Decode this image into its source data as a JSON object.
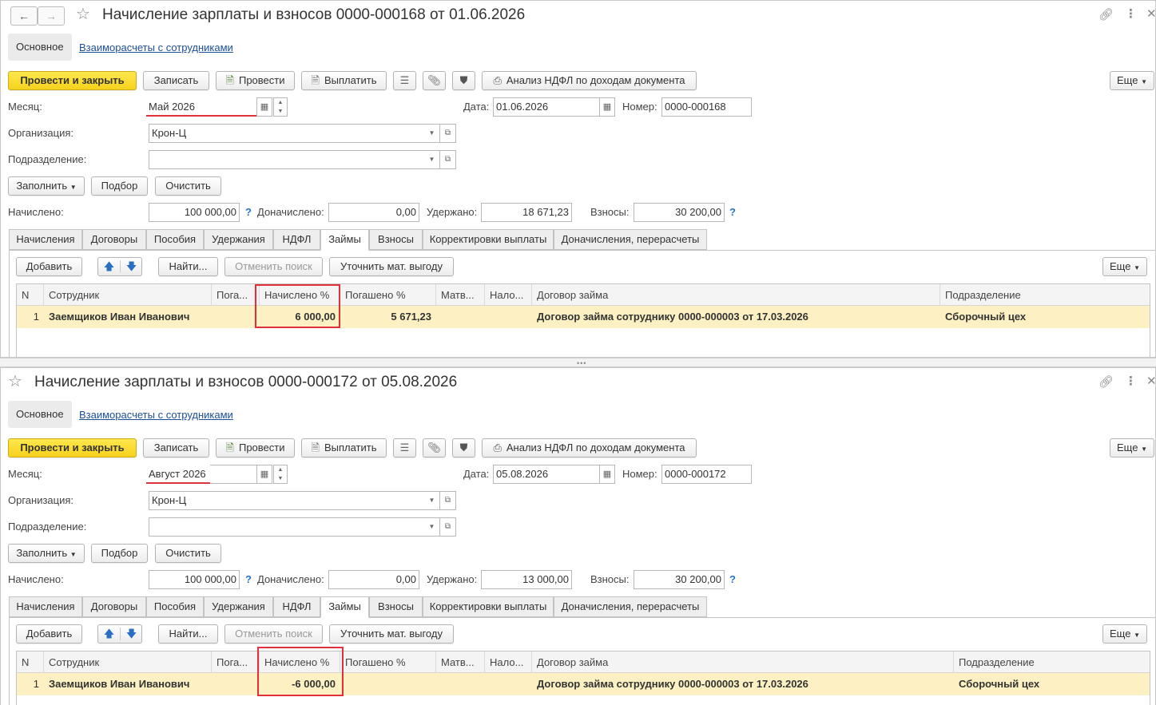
{
  "common": {
    "back_icon": "arrow-left-icon",
    "forward_icon": "arrow-right-icon",
    "tabs_main": [
      "Основное"
    ],
    "link_settlements": "Взаиморасчеты с сотрудниками",
    "btn_post_close": "Провести и закрыть",
    "btn_write": "Записать",
    "btn_post": "Провести",
    "btn_pay": "Выплатить",
    "btn_ndfl": "Анализ НДФЛ по доходам документа",
    "btn_more": "Еще",
    "lbl_month": "Месяц:",
    "lbl_date": "Дата:",
    "lbl_number": "Номер:",
    "lbl_org": "Организация:",
    "lbl_dept": "Подразделение:",
    "btn_fill": "Заполнить",
    "btn_select": "Подбор",
    "btn_clear": "Очистить",
    "lbl_accrued": "Начислено:",
    "lbl_additional": "Доначислено:",
    "lbl_withheld": "Удержано:",
    "lbl_contrib": "Взносы:",
    "help": "?",
    "tabs": [
      "Начисления",
      "Договоры",
      "Пособия",
      "Удержания",
      "НДФЛ",
      "Займы",
      "Взносы",
      "Корректировки выплаты",
      "Доначисления, перерасчеты"
    ],
    "btn_add": "Добавить",
    "btn_find": "Найти...",
    "btn_cancel_search": "Отменить поиск",
    "btn_refine": "Уточнить мат. выгоду",
    "columns": [
      "N",
      "Сотрудник",
      "Пога...",
      "Начислено %",
      "Погашено %",
      "Матв...",
      "Нало...",
      "Договор займа",
      "Подразделение"
    ]
  },
  "doc1": {
    "title": "Начисление зарплаты и взносов 0000-000168 от 01.06.2026",
    "month": "Май 2026",
    "date": "01.06.2026",
    "number": "0000-000168",
    "org": "Крон-Ц",
    "dept": "",
    "accrued": "100 000,00",
    "additional": "0,00",
    "withheld": "18 671,23",
    "contrib": "30 200,00",
    "row": {
      "n": "1",
      "employee": "Заемщиков Иван Иванович",
      "repaid_short": "",
      "accrued_pct": "6 000,00",
      "repaid_pct": "5 671,23",
      "benefit": "",
      "tax": "",
      "contract": "Договор займа сотруднику 0000-000003 от 17.03.2026",
      "dept": "Сборочный цех"
    }
  },
  "doc2": {
    "title": "Начисление зарплаты и взносов 0000-000172 от 05.08.2026",
    "month": "Август 2026",
    "date": "05.08.2026",
    "number": "0000-000172",
    "org": "Крон-Ц",
    "dept": "",
    "accrued": "100 000,00",
    "additional": "0,00",
    "withheld": "13 000,00",
    "contrib": "30 200,00",
    "row": {
      "n": "1",
      "employee": "Заемщиков Иван Иванович",
      "repaid_short": "",
      "accrued_pct": "-6 000,00",
      "repaid_pct": "",
      "benefit": "",
      "tax": "",
      "contract": "Договор займа сотруднику 0000-000003 от 17.03.2026",
      "dept": "Сборочный цех"
    }
  },
  "colors": {
    "primary_button": "#f6d21d",
    "highlight_row": "#fdf0c2",
    "annotation_red": "#e0303a",
    "link": "#1b4f9c"
  }
}
